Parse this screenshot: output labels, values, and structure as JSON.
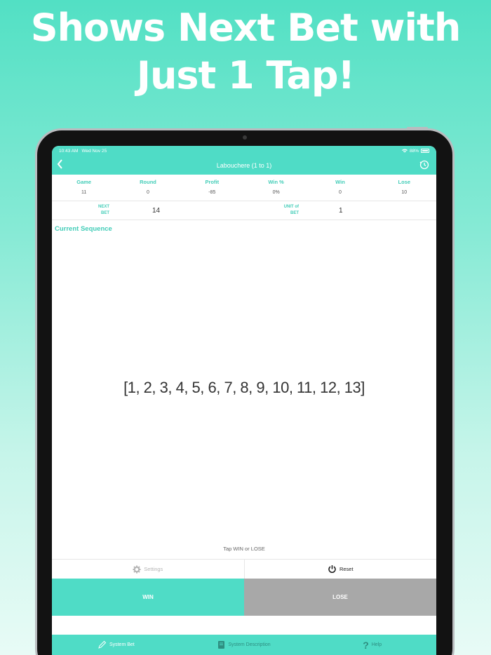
{
  "headline": {
    "line1": "Shows Next Bet with",
    "line2": "Just 1 Tap!"
  },
  "status": {
    "time": "10:43 AM",
    "date": "Wed Nov 25",
    "battery": "88%"
  },
  "nav": {
    "title": "Labouchere (1 to 1)",
    "back_icon": "chevron-left-icon",
    "history_icon": "clock-history-icon"
  },
  "stats": [
    {
      "label": "Game",
      "value": "11"
    },
    {
      "label": "Round",
      "value": "0"
    },
    {
      "label": "Profit",
      "value": "-85"
    },
    {
      "label": "Win %",
      "value": "0%"
    },
    {
      "label": "Win",
      "value": "0"
    },
    {
      "label": "Lose",
      "value": "10"
    }
  ],
  "bet": {
    "next_label_1": "NEXT",
    "next_label_2": "BET",
    "next_value": "14",
    "unit_label_1": "UNIT of",
    "unit_label_2": "BET",
    "unit_value": "1"
  },
  "sequence": {
    "title": "Current Sequence",
    "value": "[1, 2, 3, 4, 5, 6, 7, 8, 9, 10, 11, 12, 13]"
  },
  "hint": "Tap WIN or LOSE",
  "actions": {
    "settings": "Settings",
    "reset": "Reset"
  },
  "buttons": {
    "win": "WIN",
    "lose": "LOSE"
  },
  "tabs": [
    {
      "label": "System Bet",
      "icon": "pencil-icon"
    },
    {
      "label": "System Description",
      "icon": "book-icon"
    },
    {
      "label": "Help",
      "icon": "question-icon"
    }
  ],
  "colors": {
    "accent": "#4fdcc6",
    "lose": "#a8a8a8"
  }
}
